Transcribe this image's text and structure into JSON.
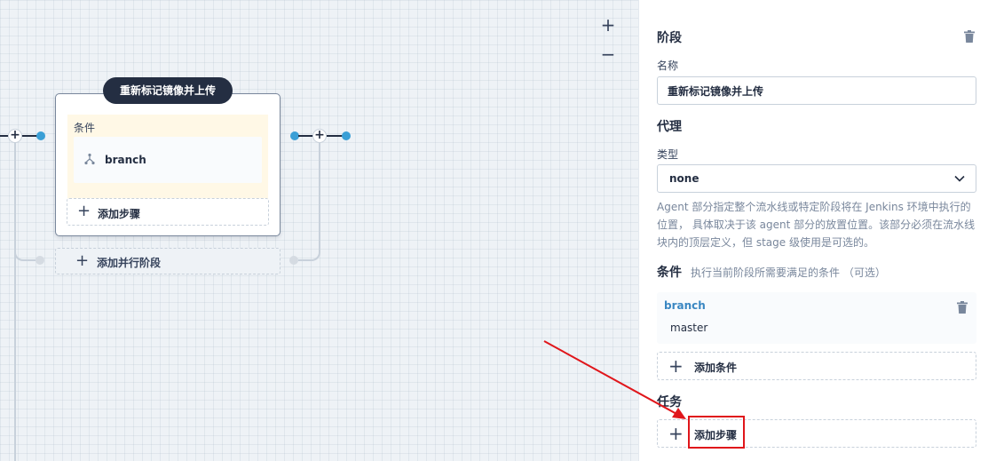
{
  "canvas": {
    "zoom_in": "+",
    "zoom_out": "−",
    "stage": {
      "title": "重新标记镜像并上传",
      "condition_label": "条件",
      "condition_item": "branch",
      "add_step": "添加步骤"
    },
    "add_parallel": "添加并行阶段"
  },
  "panel": {
    "stage_heading": "阶段",
    "name_label": "名称",
    "name_value": "重新标记镜像并上传",
    "agent_heading": "代理",
    "type_label": "类型",
    "type_value": "none",
    "agent_desc": "Agent 部分指定整个流水线或特定阶段将在 Jenkins 环境中执行的位置， 具体取决于该 agent 部分的放置位置。该部分必须在流水线块内的顶层定义，但 stage 级使用是可选的。",
    "conditions_heading": "条件",
    "conditions_sub": "执行当前阶段所需要满足的条件 （可选）",
    "condition": {
      "name": "branch",
      "value": "master"
    },
    "add_condition": "添加条件",
    "tasks_heading": "任务",
    "add_step": "添加步骤"
  },
  "colors": {
    "highlight": "#e0161b",
    "accent_blue": "#3a9fd6",
    "title_bg": "#242e42"
  }
}
